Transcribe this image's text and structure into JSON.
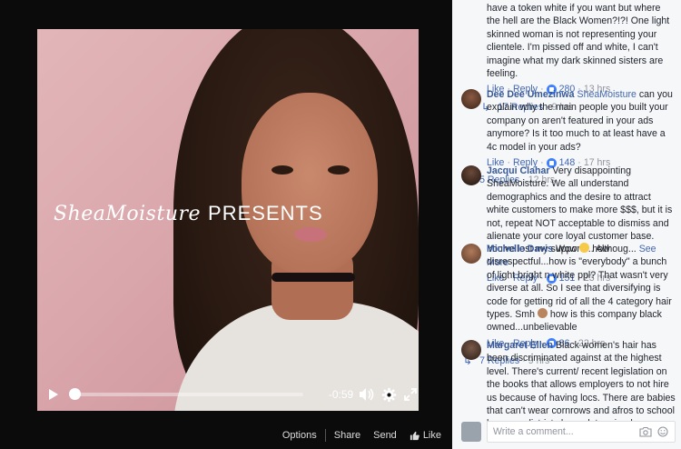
{
  "video": {
    "brand_logo": "SheaMoisture",
    "brand_title": "PRESENTS",
    "time": "-0:59",
    "progress": 0.0
  },
  "video_actions": {
    "options": "Options",
    "share": "Share",
    "send": "Send",
    "like": "Like"
  },
  "comments": {
    "top_fragment": {
      "text": "have a token white if you want but where the hell are the Black Women?!?! One light skinned woman is not representing your clientele. I'm pissed off and white, I can't imagine what my dark skinned sisters are feeling.",
      "like": "Like",
      "reply": "Reply",
      "likes": "280",
      "time": "13 hrs",
      "replies": "17 Replies",
      "replies_time": "9 hrs"
    },
    "c1": {
      "name": "Dee Dee Umezinwa",
      "page_tag": "SheaMoisture",
      "text": " can you explain why the main people you built your company on aren't featured in your ads anymore? Is it too much to at least have a 4c model in your ads?",
      "like": "Like",
      "reply": "Reply",
      "likes": "148",
      "time": "17 hrs",
      "replies": "5 Replies",
      "replies_time": "12 hrs"
    },
    "c2": {
      "name": "Jacqui Clahar",
      "text": " Very disappointing SheaMoisture. We all understand demographics and the desire to attract white customers to make more $$$, but it is not, repeat NOT acceptable to dismiss and alienate your core loyal customer base. You've lost my support ... Althoug... ",
      "see_more": "See More",
      "like": "Like",
      "reply": "Reply",
      "likes": "151",
      "time": "23 hrs"
    },
    "c3": {
      "name": "Michelle Davis",
      "text_a": " Wow ",
      "text_b": " how disrespectful...how is \"everybody\" a bunch of light bright n white ppl? That wasn't very diverse at all. So I see that diversifying is code for getting rid of all the 4 category hair types. Smh ",
      "text_c": " how is this company black owned...unbelievable",
      "like": "Like",
      "reply": "Reply",
      "likes": "86",
      "time": "22 hrs",
      "replies": "7 Replies",
      "replies_time": "9 hrs"
    },
    "c4": {
      "name": "Margaret Ellen",
      "text": " Black women's hair has been discriminated against at the highest level. There's current/ recent legislation on the books that allows employers to not hire us because of having locs. There are babies that can't wear cornrows and afros to school because districts have determined our NATURAL hair... disruptive."
    }
  },
  "composer": {
    "placeholder": "Write a comment..."
  },
  "colors": {
    "link": "#4267b2",
    "name": "#365899",
    "panel_bg": "#f6f7f9"
  }
}
